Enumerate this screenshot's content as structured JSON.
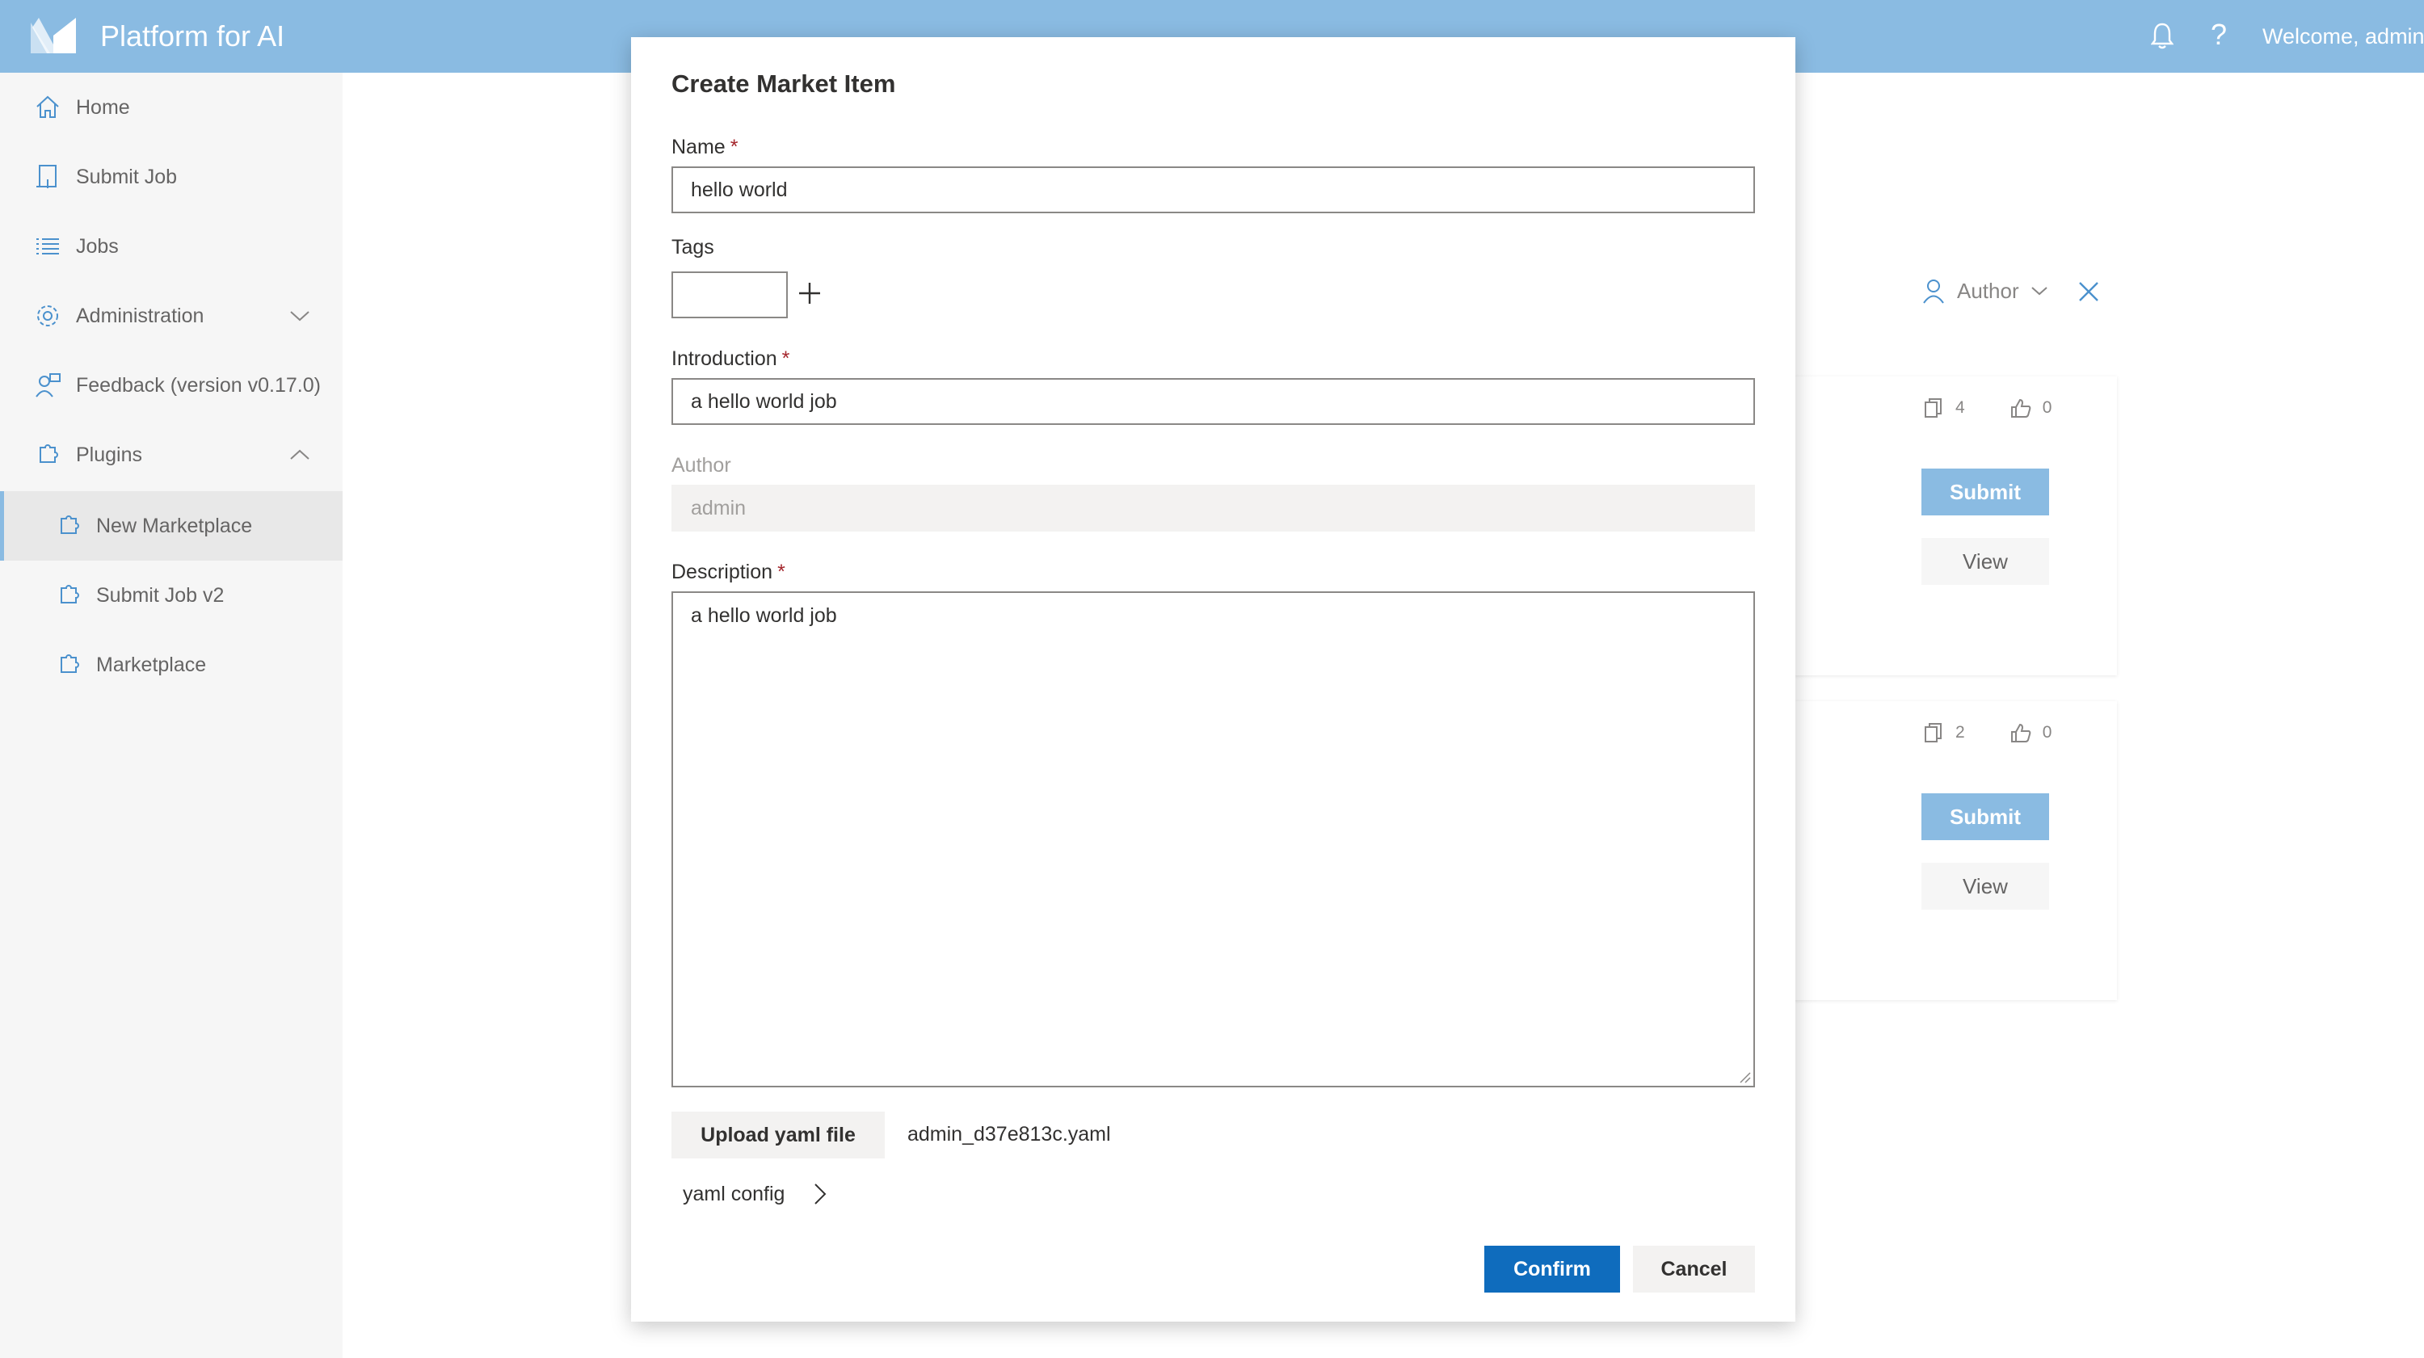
{
  "header": {
    "app_title": "Platform for AI",
    "help_glyph": "?",
    "welcome": "Welcome, admin",
    "icons": [
      "logo-icon",
      "bell-icon",
      "help-icon"
    ],
    "color": "#63a4d9"
  },
  "sidebar": {
    "items": [
      {
        "label": "Home",
        "icon": "home-icon"
      },
      {
        "label": "Submit Job",
        "icon": "submit-job-icon"
      },
      {
        "label": "Jobs",
        "icon": "list-icon"
      },
      {
        "label": "Administration",
        "icon": "gear-icon",
        "expanded": false
      },
      {
        "label": "Feedback (version v0.17.0)",
        "icon": "feedback-icon"
      },
      {
        "label": "Plugins",
        "icon": "plugin-icon",
        "expanded": true
      },
      {
        "label": "New Marketplace",
        "icon": "plugin-icon",
        "active": true
      },
      {
        "label": "Submit Job v2",
        "icon": "plugin-icon"
      },
      {
        "label": "Marketplace",
        "icon": "plugin-icon"
      }
    ]
  },
  "main": {
    "author_filter_label": "Author",
    "cards": [
      {
        "copies": "4",
        "likes": "0",
        "submit_label": "Submit",
        "view_label": "View"
      },
      {
        "copies": "2",
        "likes": "0",
        "submit_label": "Submit",
        "view_label": "View"
      }
    ]
  },
  "dialog": {
    "title": "Create Market Item",
    "name": {
      "label": "Name",
      "required_mark": "*",
      "value": "hello world"
    },
    "tags": {
      "label": "Tags",
      "value": ""
    },
    "introduction": {
      "label": "Introduction",
      "required_mark": "*",
      "value": "a hello world job"
    },
    "author": {
      "label": "Author",
      "value": "admin"
    },
    "description": {
      "label": "Description",
      "required_mark": "*",
      "value": "a hello world job"
    },
    "upload_label": "Upload yaml file",
    "uploaded_file": "admin_d37e813c.yaml",
    "yaml_config_label": "yaml config",
    "confirm_label": "Confirm",
    "cancel_label": "Cancel",
    "colors": {
      "primary": "#0f6cbd",
      "required": "#a4262c"
    }
  }
}
